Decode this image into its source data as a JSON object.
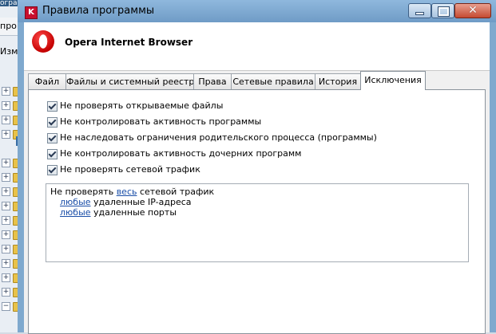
{
  "background_app": {
    "top_fragment": "ограф",
    "row1_fragment": "про",
    "row2_fragment": "Изм"
  },
  "window": {
    "title": "Правила программы",
    "icon_letter": "K",
    "close_glyph": "✕"
  },
  "header": {
    "app_name": "Opera Internet Browser"
  },
  "tabs": [
    {
      "label": "Файл"
    },
    {
      "label": "Файлы и системный реестр"
    },
    {
      "label": "Права"
    },
    {
      "label": "Сетевые правила"
    },
    {
      "label": "История"
    },
    {
      "label": "Исключения"
    }
  ],
  "active_tab": "Исключения",
  "checkboxes": [
    {
      "label": "Не проверять открываемые файлы",
      "checked": true
    },
    {
      "label": "Не контролировать активность программы",
      "checked": true
    },
    {
      "label": "Не наследовать ограничения родительского процесса (программы)",
      "checked": true
    },
    {
      "label": "Не контролировать активность дочерних программ",
      "checked": true
    },
    {
      "label": "Не проверять сетевой трафик",
      "checked": true
    }
  ],
  "description": {
    "line1_prefix": "Не проверять ",
    "line1_link": "весь",
    "line1_suffix": " сетевой трафик",
    "line2_link": "любые",
    "line2_suffix": " удаленные IP-адреса",
    "line3_link": "любые",
    "line3_suffix": " удаленные порты"
  },
  "colors": {
    "titlebar": "#7fa9ce",
    "link": "#1a4ea8",
    "close_button": "#c44a32"
  }
}
